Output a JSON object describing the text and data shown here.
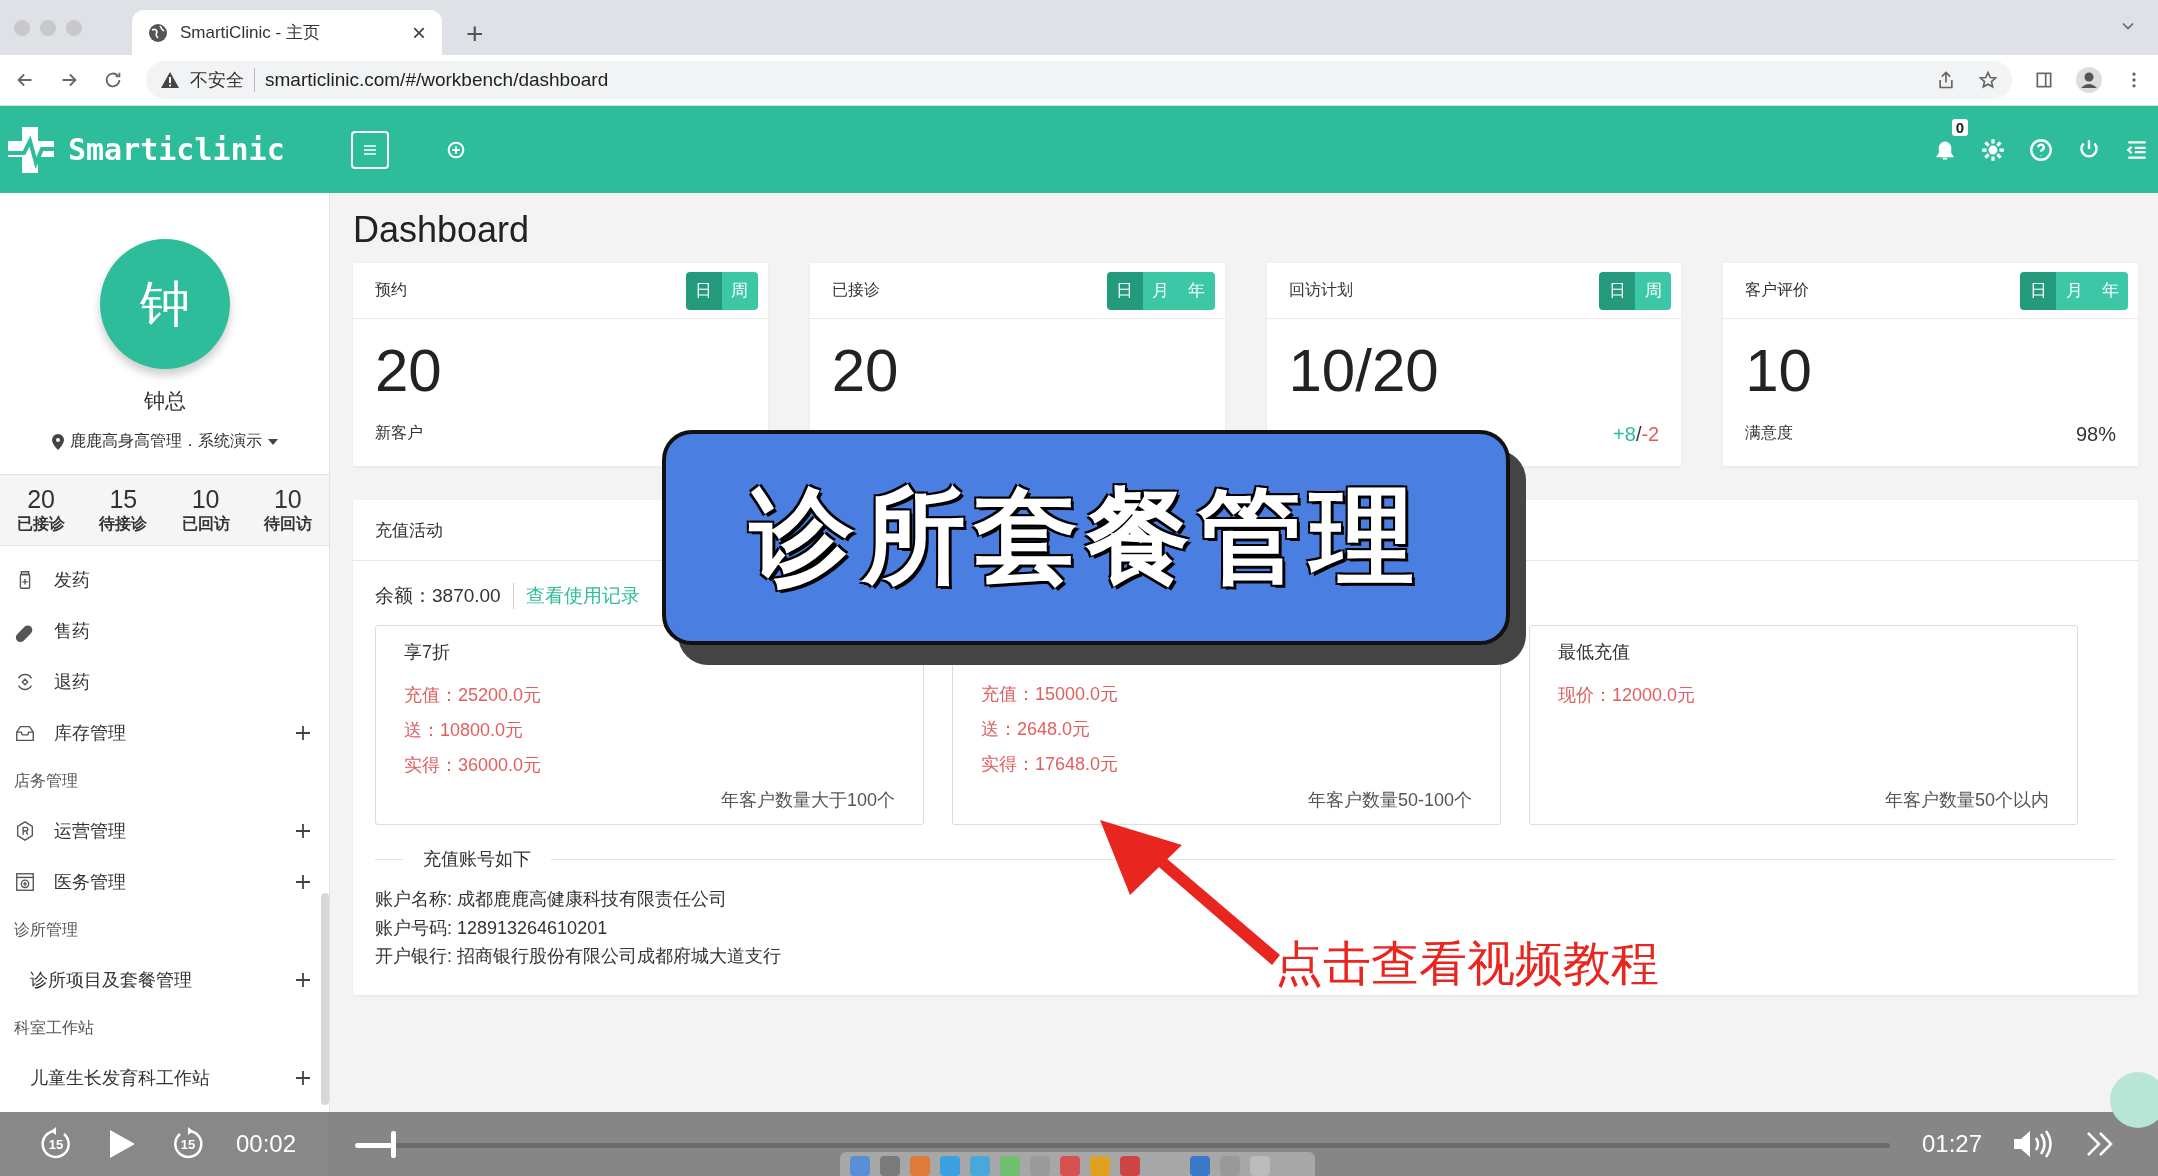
{
  "browser": {
    "tab_title": "SmartiClinic - 主页",
    "tab_close": "×",
    "new_tab": "+",
    "security": "不安全",
    "url": "smarticlinic.com/#/workbench/dashboard"
  },
  "header": {
    "brand": "Smarticlinic",
    "notification_count": "0"
  },
  "sidebar": {
    "avatar": "钟",
    "user": "钟总",
    "org": "鹿鹿高身高管理．系统演示",
    "stats": [
      {
        "value": "20",
        "label": "已接诊"
      },
      {
        "value": "15",
        "label": "待接诊"
      },
      {
        "value": "10",
        "label": "已回访"
      },
      {
        "value": "10",
        "label": "待回访"
      }
    ],
    "menu": [
      {
        "kind": "item",
        "label": "发药",
        "expandable": false
      },
      {
        "kind": "item",
        "label": "售药",
        "expandable": false
      },
      {
        "kind": "item",
        "label": "退药",
        "expandable": false
      },
      {
        "kind": "item",
        "label": "库存管理",
        "expandable": true
      },
      {
        "kind": "section",
        "label": "店务管理"
      },
      {
        "kind": "item",
        "label": "运营管理",
        "expandable": true
      },
      {
        "kind": "item",
        "label": "医务管理",
        "expandable": true
      },
      {
        "kind": "section",
        "label": "诊所管理"
      },
      {
        "kind": "subitem",
        "label": "诊所项目及套餐管理",
        "expandable": true
      },
      {
        "kind": "section",
        "label": "科室工作站"
      },
      {
        "kind": "subitem",
        "label": "儿童生长发育科工作站",
        "expandable": true
      }
    ]
  },
  "dashboard": {
    "title": "Dashboard",
    "cards": [
      {
        "title": "预约",
        "periods": [
          {
            "label": "日",
            "selected": true
          },
          {
            "label": "周",
            "selected": false
          }
        ],
        "value": "20",
        "footer_label": "新客户"
      },
      {
        "title": "已接诊",
        "periods": [
          {
            "label": "日",
            "selected": true
          },
          {
            "label": "月",
            "selected": false
          },
          {
            "label": "年",
            "selected": false
          }
        ],
        "value": "20"
      },
      {
        "title": "回访计划",
        "periods": [
          {
            "label": "日",
            "selected": true
          },
          {
            "label": "周",
            "selected": false
          }
        ],
        "value": "10/20",
        "trend": {
          "gain": "+8",
          "separator": "/",
          "loss": "-2"
        }
      },
      {
        "title": "客户评价",
        "periods": [
          {
            "label": "日",
            "selected": true
          },
          {
            "label": "月",
            "selected": false
          },
          {
            "label": "年",
            "selected": false
          }
        ],
        "value": "10",
        "footer_label": "满意度",
        "footer_value": "98%"
      }
    ]
  },
  "recharge": {
    "title": "充值活动",
    "balance": "余额：3870.00",
    "history_link": "查看使用记录",
    "plans": [
      {
        "title": "享7折",
        "lines": [
          "充值：25200.0元",
          "送：10800.0元",
          "实得：36000.0元"
        ],
        "note": "年客户数量大于100个"
      },
      {
        "lines": [
          "充值：15000.0元",
          "送：2648.0元",
          "实得：17648.0元"
        ],
        "note": "年客户数量50-100个"
      },
      {
        "title": "最低充值",
        "lines": [
          "现价：12000.0元"
        ],
        "note": "年客户数量50个以内"
      }
    ],
    "account_heading": "充值账号如下",
    "account_lines": [
      "账户名称: 成都鹿鹿高健康科技有限责任公司",
      "账户号码: 128913264610201",
      "开户银行: 招商银行股份有限公司成都府城大道支行"
    ]
  },
  "overlay": {
    "banner": "诊所套餐管理",
    "callout": "点击查看视频教程"
  },
  "player": {
    "skip_back": "15",
    "skip_forward": "15",
    "elapsed": "00:02",
    "remaining": "01:27",
    "level": 0.025
  }
}
